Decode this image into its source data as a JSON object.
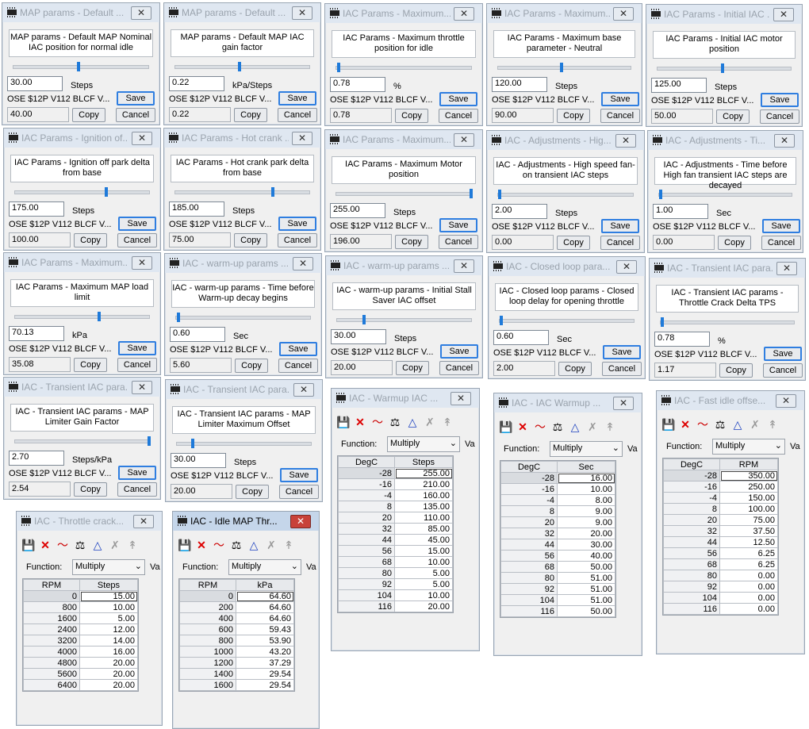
{
  "common": {
    "source": "OSE $12P V112 BLCF V...",
    "save": "Save",
    "copy": "Copy",
    "cancel": "Cancel",
    "function_label": "Function:",
    "function_value": "Multiply",
    "va": "Va"
  },
  "param_windows": [
    {
      "title": "MAP params - Default ...",
      "desc": "MAP params - Default MAP Nominal IAC position for normal idle",
      "value": "30.00",
      "unit": "Steps",
      "default": "40.00",
      "slider": 0.48
    },
    {
      "title": "MAP params - Default ...",
      "desc": "MAP params - Default MAP IAC gain factor",
      "value": "0.22",
      "unit": "kPa/Steps",
      "default": "0.22",
      "slider": 0.48
    },
    {
      "title": "IAC Params - Maximum...",
      "desc": "IAC Params - Maximum throttle position for idle",
      "value": "0.78",
      "unit": "%",
      "default": "0.78",
      "slider": 0.02
    },
    {
      "title": "IAC Params - Maximum...",
      "desc": "IAC Params - Maximum base parameter - Neutral",
      "value": "120.00",
      "unit": "Steps",
      "default": "90.00",
      "slider": 0.48
    },
    {
      "title": "IAC Params - Initial IAC ...",
      "desc": "IAC Params - Initial IAC motor position",
      "value": "125.00",
      "unit": "Steps",
      "default": "50.00",
      "slider": 0.49
    },
    {
      "title": "IAC Params - Ignition of...",
      "desc": "IAC Params - Ignition off park delta from base",
      "value": "175.00",
      "unit": "Steps",
      "default": "100.00",
      "slider": 0.68
    },
    {
      "title": "IAC Params - Hot crank ...",
      "desc": "IAC Params - Hot crank park delta from base",
      "value": "185.00",
      "unit": "Steps",
      "default": "75.00",
      "slider": 0.73
    },
    {
      "title": "IAC Params - Maximum...",
      "desc": "IAC Params - Maximum Motor position",
      "value": "255.00",
      "unit": "Steps",
      "default": "196.00",
      "slider": 1.0
    },
    {
      "title": "IAC - Adjustments - Hig...",
      "desc": "IAC - Adjustments - High speed fan-on transient IAC steps",
      "value": "2.00",
      "unit": "Steps",
      "default": "0.00",
      "slider": 0.01
    },
    {
      "title": "IAC - Adjustments - Ti...",
      "desc": "IAC - Adjustments - Time before High fan transient IAC steps are decayed",
      "value": "1.00",
      "unit": "Sec",
      "default": "0.00",
      "slider": 0.01
    },
    {
      "title": "IAC Params - Maximum...",
      "desc": "IAC Params - Maximum MAP load limit",
      "value": "70.13",
      "unit": "kPa",
      "default": "35.08",
      "slider": 0.63
    },
    {
      "title": "IAC - warm-up params ...",
      "desc": "IAC - warm-up params - Time before Warm-up decay begins",
      "value": "0.60",
      "unit": "Sec",
      "default": "5.60",
      "slider": 0.02
    },
    {
      "title": "IAC - warm-up params ...",
      "desc": "IAC - warm-up params - Initial Stall Saver IAC offset",
      "value": "30.00",
      "unit": "Steps",
      "default": "20.00",
      "slider": 0.2
    },
    {
      "title": "IAC - Closed loop para...",
      "desc": "IAC - Closed loop params - Closed loop delay for opening throttle",
      "value": "0.60",
      "unit": "Sec",
      "default": "2.00",
      "slider": 0.01
    },
    {
      "title": "IAC - Transient IAC para...",
      "desc": "IAC - Transient IAC params - Throttle Crack Delta TPS",
      "value": "0.78",
      "unit": "%",
      "default": "1.17",
      "slider": 0.01
    },
    {
      "title": "IAC - Transient IAC para...",
      "desc": "IAC - Transient IAC params - MAP Limiter Gain Factor",
      "value": "2.70",
      "unit": "Steps/kPa",
      "default": "2.54",
      "slider": 1.0
    },
    {
      "title": "IAC - Transient IAC para...",
      "desc": "IAC - Transient IAC params - MAP Limiter Maximum Offset",
      "value": "30.00",
      "unit": "Steps",
      "default": "20.00",
      "slider": 0.12
    }
  ],
  "table_windows": [
    {
      "title": "IAC - Warmup IAC ...",
      "col1": "DegC",
      "col2": "Steps",
      "rows": [
        [
          "-28",
          "255.00"
        ],
        [
          "-16",
          "210.00"
        ],
        [
          "-4",
          "160.00"
        ],
        [
          "8",
          "135.00"
        ],
        [
          "20",
          "110.00"
        ],
        [
          "32",
          "85.00"
        ],
        [
          "44",
          "45.00"
        ],
        [
          "56",
          "15.00"
        ],
        [
          "68",
          "10.00"
        ],
        [
          "80",
          "5.00"
        ],
        [
          "92",
          "5.00"
        ],
        [
          "104",
          "10.00"
        ],
        [
          "116",
          "20.00"
        ]
      ]
    },
    {
      "title": "IAC - IAC Warmup ...",
      "col1": "DegC",
      "col2": "Sec",
      "rows": [
        [
          "-28",
          "16.00"
        ],
        [
          "-16",
          "10.00"
        ],
        [
          "-4",
          "8.00"
        ],
        [
          "8",
          "9.00"
        ],
        [
          "20",
          "9.00"
        ],
        [
          "32",
          "20.00"
        ],
        [
          "44",
          "30.00"
        ],
        [
          "56",
          "40.00"
        ],
        [
          "68",
          "50.00"
        ],
        [
          "80",
          "51.00"
        ],
        [
          "92",
          "51.00"
        ],
        [
          "104",
          "51.00"
        ],
        [
          "116",
          "50.00"
        ]
      ]
    },
    {
      "title": "IAC - Fast idle offse...",
      "col1": "DegC",
      "col2": "RPM",
      "rows": [
        [
          "-28",
          "350.00"
        ],
        [
          "-16",
          "250.00"
        ],
        [
          "-4",
          "150.00"
        ],
        [
          "8",
          "100.00"
        ],
        [
          "20",
          "75.00"
        ],
        [
          "32",
          "37.50"
        ],
        [
          "44",
          "12.50"
        ],
        [
          "56",
          "6.25"
        ],
        [
          "68",
          "6.25"
        ],
        [
          "80",
          "0.00"
        ],
        [
          "92",
          "0.00"
        ],
        [
          "104",
          "0.00"
        ],
        [
          "116",
          "0.00"
        ]
      ]
    },
    {
      "title": "IAC - Throttle crack...",
      "col1": "RPM",
      "col2": "Steps",
      "rows": [
        [
          "0",
          "15.00"
        ],
        [
          "800",
          "10.00"
        ],
        [
          "1600",
          "5.00"
        ],
        [
          "2400",
          "12.00"
        ],
        [
          "3200",
          "14.00"
        ],
        [
          "4000",
          "16.00"
        ],
        [
          "4800",
          "20.00"
        ],
        [
          "5600",
          "20.00"
        ],
        [
          "6400",
          "20.00"
        ]
      ]
    },
    {
      "title": "IAC - Idle MAP Thr...",
      "col1": "RPM",
      "col2": "kPa",
      "rows": [
        [
          "0",
          "64.60"
        ],
        [
          "200",
          "64.60"
        ],
        [
          "400",
          "64.60"
        ],
        [
          "600",
          "59.43"
        ],
        [
          "800",
          "53.90"
        ],
        [
          "1000",
          "43.20"
        ],
        [
          "1200",
          "37.29"
        ],
        [
          "1400",
          "29.54"
        ],
        [
          "1600",
          "29.54"
        ]
      ]
    }
  ]
}
